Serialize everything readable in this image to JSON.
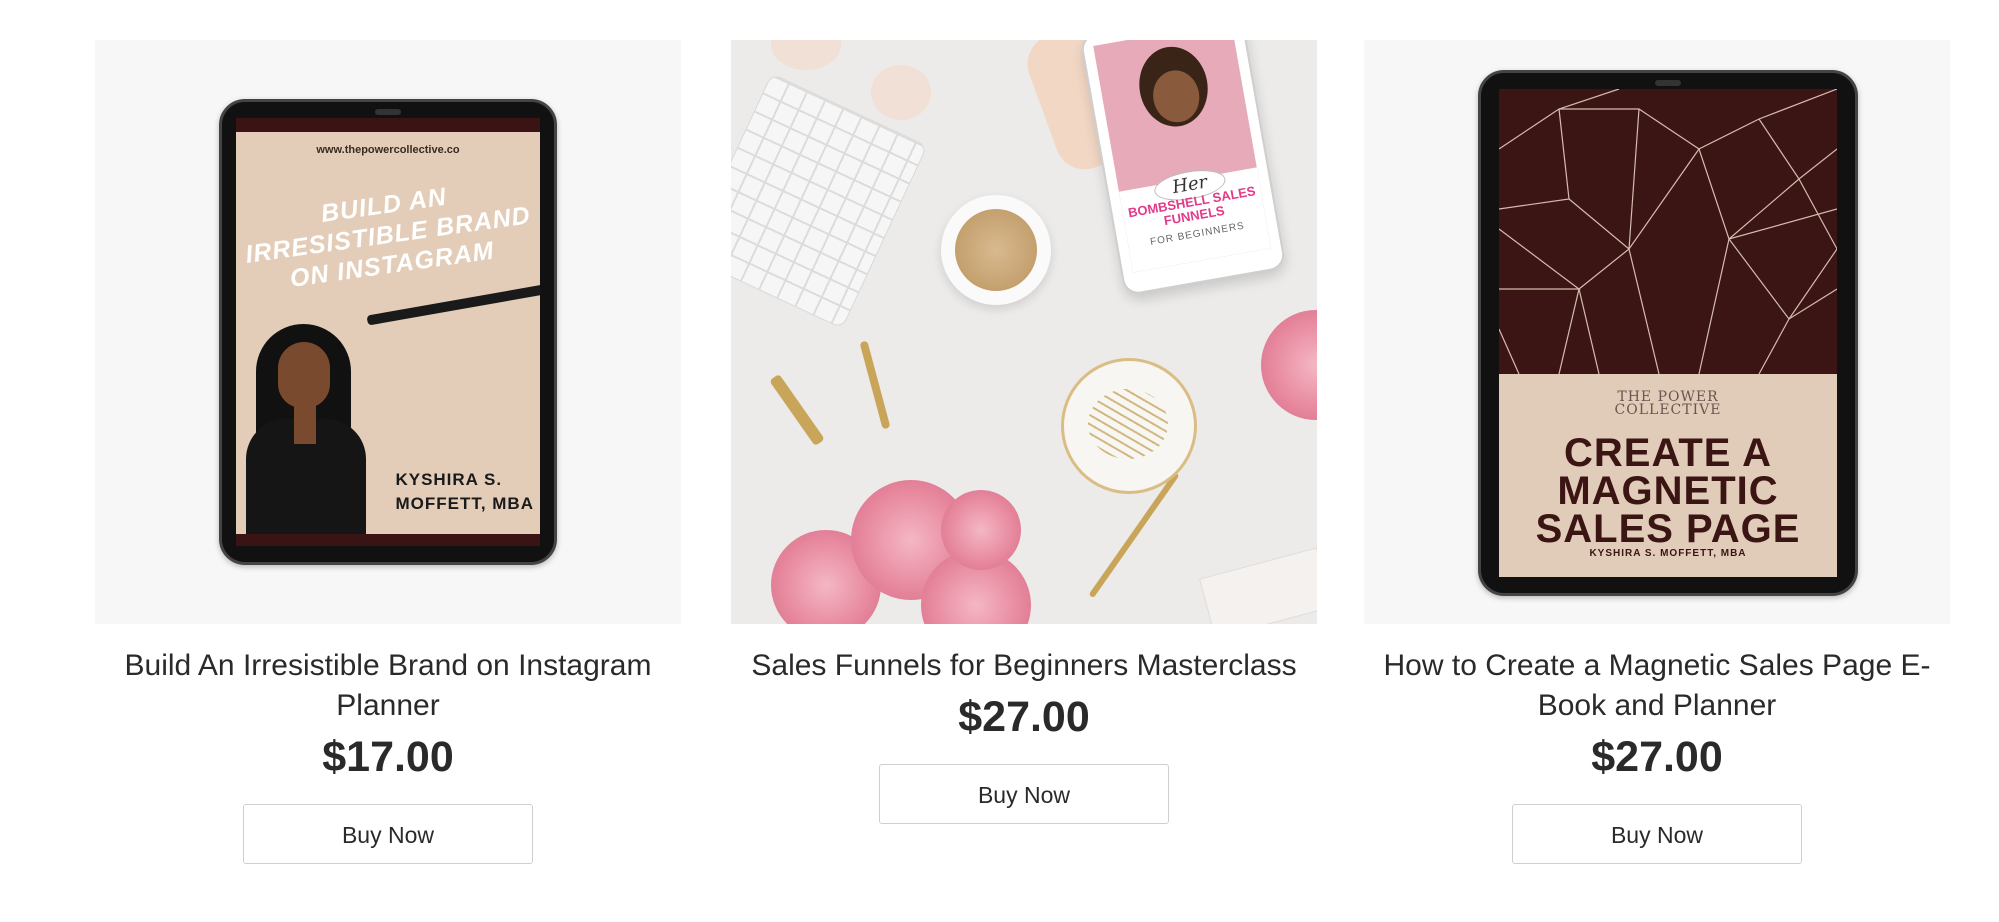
{
  "products": [
    {
      "title": "Build An Irresistible Brand on Instagram Planner",
      "price": "$17.00",
      "button_label": "Buy Now",
      "cover": {
        "url": "www.thepowercollective.co",
        "headline_line1": "BUILD AN",
        "headline_line2": "IRRESISTIBLE BRAND",
        "headline_line3": "ON INSTAGRAM",
        "author_line1": "KYSHIRA S.",
        "author_line2": "MOFFETT, MBA",
        "colors": {
          "background": "#e3cdb8",
          "accent": "#3a1414"
        }
      }
    },
    {
      "title": "Sales Funnels for Beginners Masterclass",
      "price": "$27.00",
      "button_label": "Buy Now",
      "cover": {
        "logo": "Her",
        "phone_title_line1": "BOMBSHELL SALES",
        "phone_title_line2": "FUNNELS",
        "phone_subtitle": "FOR BEGINNERS",
        "colors": {
          "accent": "#e03c8a",
          "screen": "#e7aab9"
        }
      }
    },
    {
      "title": "How to Create a Magnetic Sales Page E-Book and Planner",
      "price": "$27.00",
      "button_label": "Buy Now",
      "cover": {
        "brand_line1": "THE POWER",
        "brand_line2": "COLLECTIVE",
        "headline_line1": "CREATE A",
        "headline_line2": "MAGNETIC",
        "headline_line3": "SALES PAGE",
        "author": "KYSHIRA S. MOFFETT, MBA",
        "colors": {
          "dark": "#3b1414",
          "light": "#e1ccb9"
        }
      }
    }
  ]
}
